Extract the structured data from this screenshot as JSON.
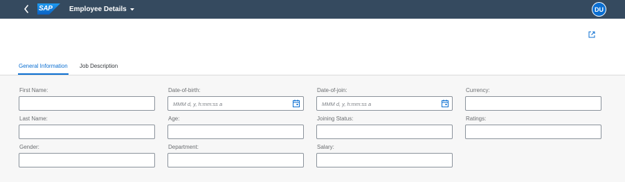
{
  "shell": {
    "logo_text": "SAP",
    "title": "Employee Details",
    "user_initials": "DU",
    "icons": {
      "back": "chevron-left-icon",
      "title_menu": "caret-down-icon",
      "export": "external-link-icon"
    }
  },
  "tabs": [
    {
      "label": "General Information",
      "selected": true
    },
    {
      "label": "Job Description",
      "selected": false
    }
  ],
  "form": {
    "col1": {
      "first_name": {
        "label": "First Name:",
        "value": ""
      },
      "last_name": {
        "label": "Last Name:",
        "value": ""
      },
      "gender": {
        "label": "Gender:",
        "value": ""
      }
    },
    "col2": {
      "dob": {
        "label": "Date-of-birth:",
        "placeholder": "MMM d, y, h:mm:ss a",
        "icon": "calendar-icon"
      },
      "age": {
        "label": "Age:",
        "value": ""
      },
      "department": {
        "label": "Department:",
        "value": ""
      }
    },
    "col3": {
      "doj": {
        "label": "Date-of-join:",
        "placeholder": "MMM d, y, h:mm:ss a",
        "icon": "calendar-icon"
      },
      "joining_status": {
        "label": "Joining Status:",
        "value": ""
      },
      "salary": {
        "label": "Salary:",
        "value": ""
      }
    },
    "col4": {
      "currency": {
        "label": "Currency:",
        "value": ""
      },
      "ratings": {
        "label": "Ratings:",
        "value": ""
      }
    }
  },
  "colors": {
    "shell_bar": "#354a5f",
    "accent": "#0a6ed1",
    "page_background": "#f7f7f7",
    "header_background": "#ffffff",
    "input_border": "#89919a"
  }
}
